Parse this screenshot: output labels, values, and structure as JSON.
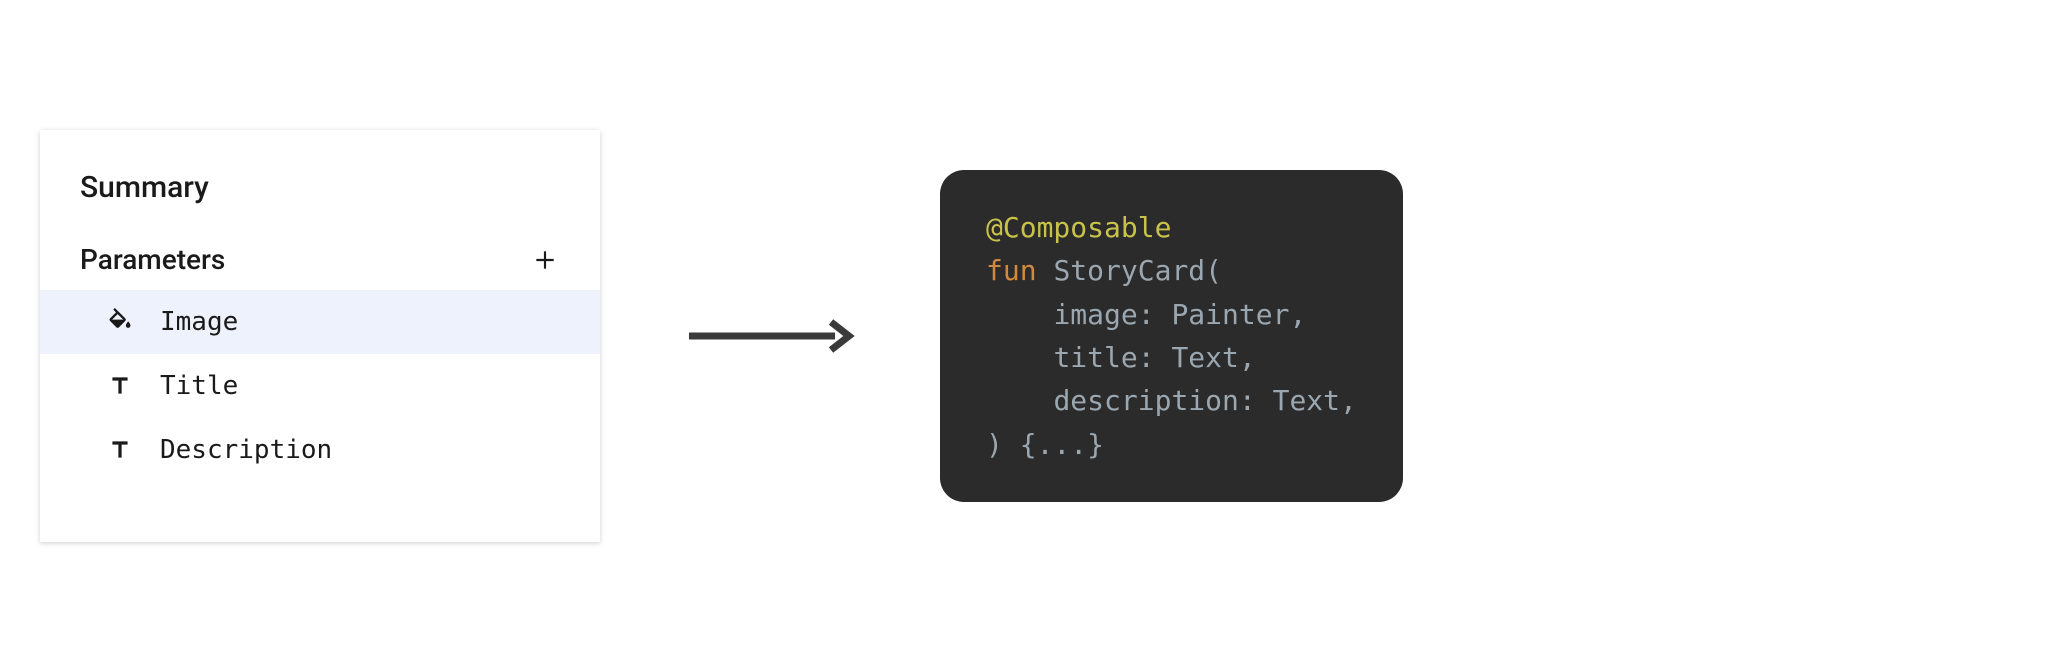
{
  "panel": {
    "title": "Summary",
    "section_label": "Parameters",
    "params": [
      {
        "icon": "fill",
        "label": "Image",
        "selected": true
      },
      {
        "icon": "text",
        "label": "Title",
        "selected": false
      },
      {
        "icon": "text",
        "label": "Description",
        "selected": false
      }
    ]
  },
  "code": {
    "annotation": "@Composable",
    "keyword": "fun",
    "func_name": "StoryCard",
    "open_paren": "(",
    "params": [
      {
        "name": "image",
        "type": "Painter"
      },
      {
        "name": "title",
        "type": "Text"
      },
      {
        "name": "description",
        "type": "Text"
      }
    ],
    "closing": ") {...}"
  }
}
